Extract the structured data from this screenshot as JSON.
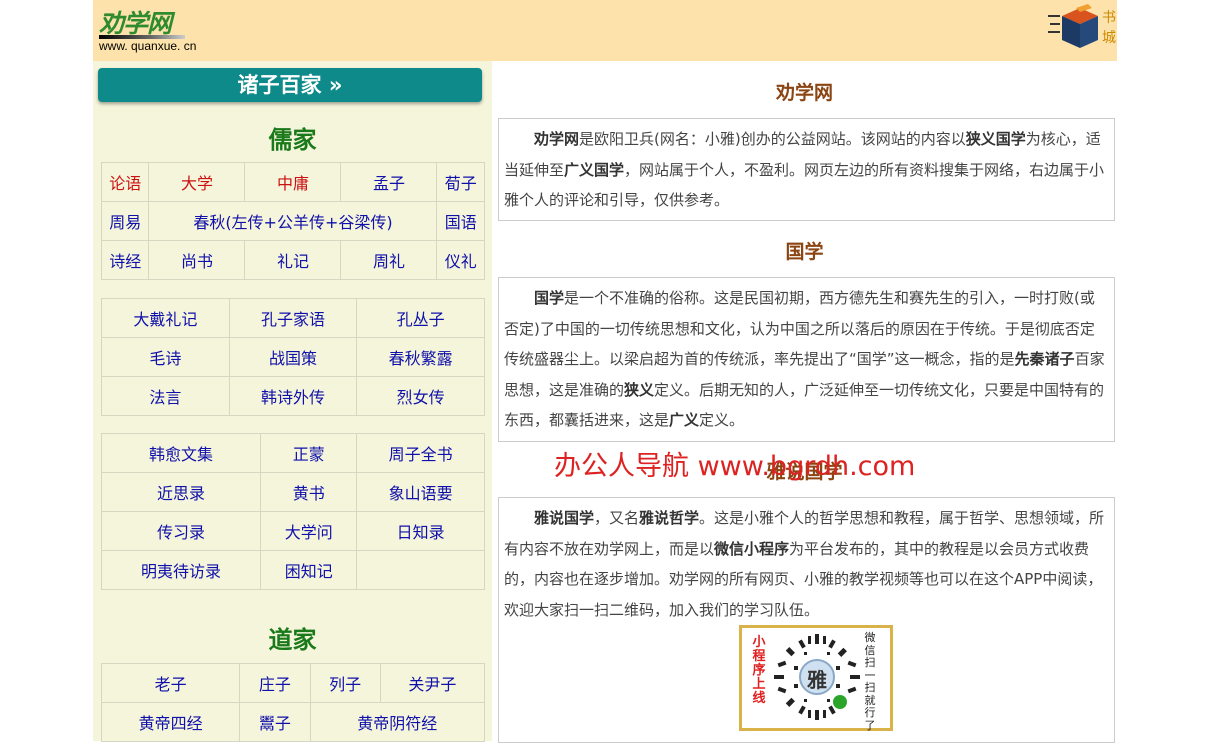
{
  "header": {
    "logo_text": "劝学网",
    "logo_url": "www. quanxue. cn",
    "shop_label": "书城"
  },
  "sidebar": {
    "zhuzi_button": "诸子百家 »",
    "confucian": {
      "title": "儒家",
      "group1": [
        [
          {
            "t": "论语",
            "red": true
          },
          {
            "t": "大学",
            "red": true
          },
          {
            "t": "中庸",
            "red": true
          },
          {
            "t": "孟子"
          },
          {
            "t": "荀子"
          }
        ],
        [
          {
            "t": "周易"
          },
          {
            "t": "春秋(左传+公羊传+谷梁传)",
            "span": 3
          },
          {
            "t": "国语"
          }
        ],
        [
          {
            "t": "诗经"
          },
          {
            "t": "尚书"
          },
          {
            "t": "礼记"
          },
          {
            "t": "周礼"
          },
          {
            "t": "仪礼"
          }
        ]
      ],
      "group2": [
        [
          {
            "t": "大戴礼记"
          },
          {
            "t": "孔子家语"
          },
          {
            "t": "孔丛子"
          }
        ],
        [
          {
            "t": "毛诗"
          },
          {
            "t": "战国策"
          },
          {
            "t": "春秋繁露"
          }
        ],
        [
          {
            "t": "法言"
          },
          {
            "t": "韩诗外传"
          },
          {
            "t": "烈女传"
          }
        ]
      ],
      "group3": [
        [
          {
            "t": "韩愈文集"
          },
          {
            "t": "正蒙"
          },
          {
            "t": "周子全书"
          }
        ],
        [
          {
            "t": "近思录"
          },
          {
            "t": "黄书"
          },
          {
            "t": "象山语要"
          }
        ],
        [
          {
            "t": "传习录"
          },
          {
            "t": "大学问"
          },
          {
            "t": "日知录"
          }
        ],
        [
          {
            "t": "明夷待访录"
          },
          {
            "t": "困知记"
          },
          {
            "t": ""
          }
        ]
      ]
    },
    "taoist": {
      "title": "道家",
      "group1": [
        [
          {
            "t": "老子"
          },
          {
            "t": "庄子"
          },
          {
            "t": "列子"
          },
          {
            "t": "关尹子"
          }
        ],
        [
          {
            "t": "黄帝四经"
          },
          {
            "t": "鬻子"
          },
          {
            "t": "黄帝阴符经",
            "span": 2
          }
        ]
      ]
    }
  },
  "main": {
    "sec1_title": "劝学网",
    "sec1_body": [
      {
        "b": "劝学网"
      },
      "是欧阳卫兵(网名：小雅)创办的公益网站。该网站的内容以",
      {
        "b": "狭义国学"
      },
      "为核心，适当延伸至",
      {
        "b": "广义国学"
      },
      "，网站属于个人，不盈利。网页左边的所有资料搜集于网络，右边属于小雅个人的评论和引导，仅供参考。"
    ],
    "sec2_title": "国学",
    "sec2_body": [
      {
        "b": "国学"
      },
      "是一个不准确的俗称。这是民国初期，西方德先生和赛先生的引入，一时打败(或否定)了中国的一切传统思想和文化，认为中国之所以落后的原因在于传统。于是彻底否定传统盛器尘上。以梁启超为首的传统派，率先提出了“国学”这一概念，指的是",
      {
        "b": "先秦诸子"
      },
      "百家思想，这是准确的",
      {
        "b": "狭义"
      },
      "定义。后期无知的人，广泛延伸至一切传统文化，只要是中国特有的东西，都囊括进来，这是",
      {
        "b": "广义"
      },
      "定义。"
    ],
    "sec3_title": "雅说国学",
    "watermark": "办公人导航  www.bgrdh.com",
    "sec3_body": [
      {
        "b": "雅说国学"
      },
      "，又名",
      {
        "b": "雅说哲学"
      },
      "。这是小雅个人的哲学思想和教程，属于哲学、思想领域，所有内容不放在劝学网上，而是以",
      {
        "b": "微信小程序"
      },
      "为平台发布的，其中的教程是以会员方式收费的，内容也在逐步增加。劝学网的所有网页、小雅的教学视频等也可以在这个APP中阅读，欢迎大家扫一扫二维码，加入我们的学习队伍。"
    ],
    "qr": {
      "left_text": "小程序上线",
      "right_text": "微信扫一扫就行了",
      "center_char": "雅"
    }
  }
}
